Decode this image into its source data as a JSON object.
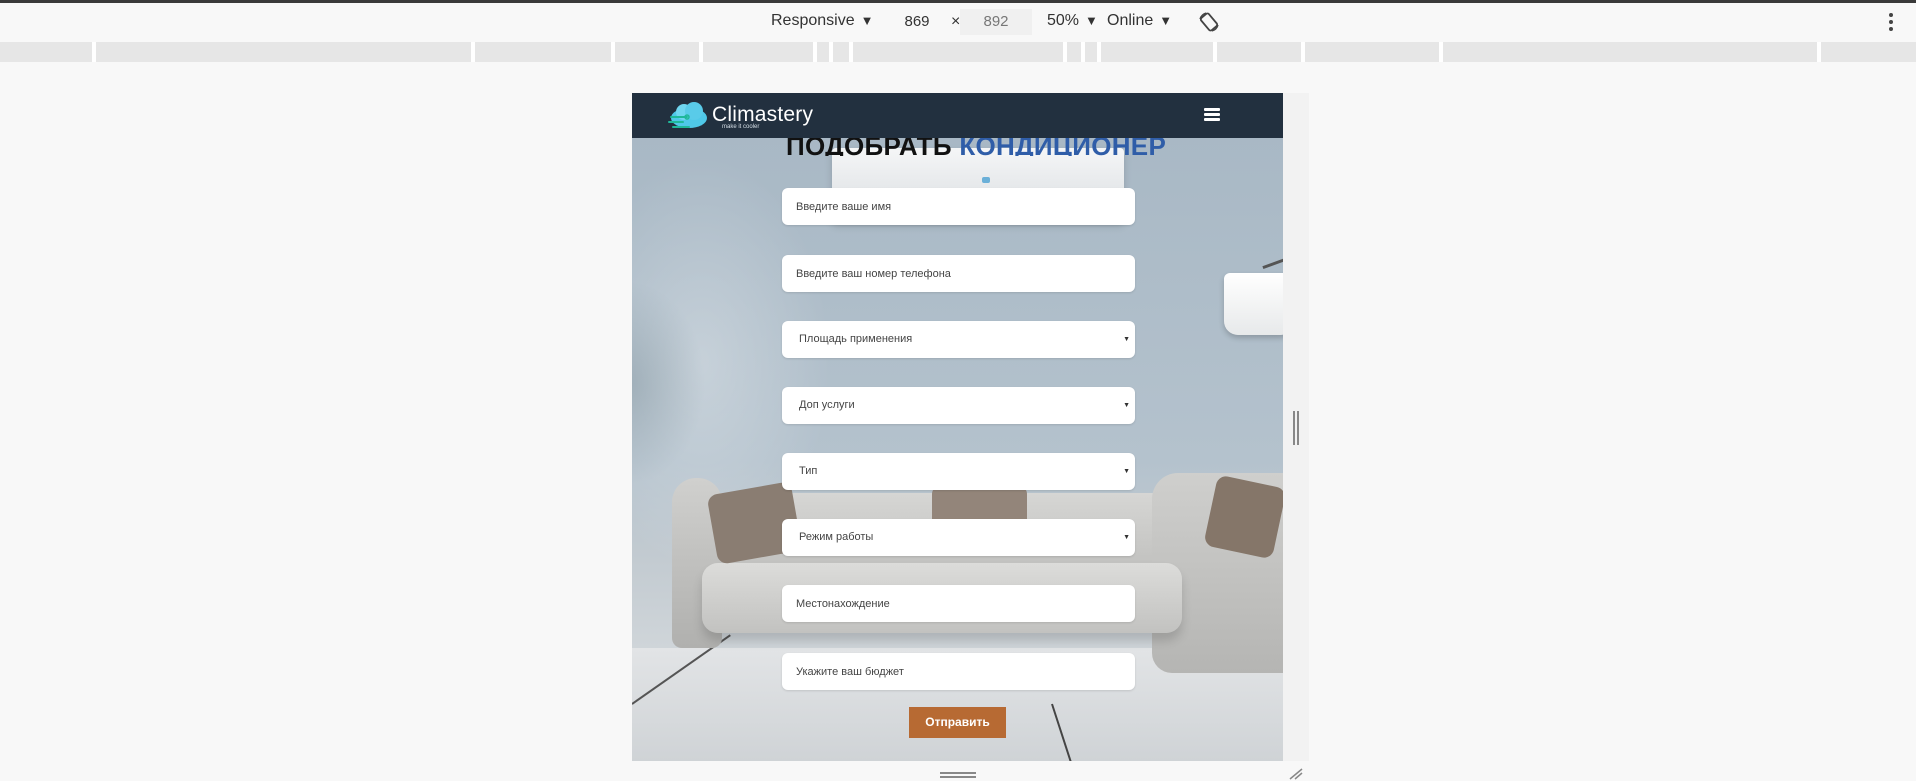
{
  "devtools": {
    "device": "Responsive",
    "width": "869",
    "height": "892",
    "times": "×",
    "zoom": "50%",
    "network": "Online",
    "rotate_icon": "rotate-icon",
    "menu_icon": "kebab-icon"
  },
  "site": {
    "logo": {
      "name": "Climastery",
      "tagline": "make it cooler"
    },
    "menu_icon": "hamburger-icon",
    "title_part1": "ПОДОБРАТЬ",
    "title_part2": "КОНДИЦИОНЕР",
    "colors": {
      "header_bg": "#22303f",
      "title_accent": "#2f5da8",
      "submit_bg": "#b76a33"
    },
    "form": {
      "name_placeholder": "Введите ваше имя",
      "phone_placeholder": "Введите ваш номер телефона",
      "area_select": "Площадь применения",
      "extras_select": "Доп услуги",
      "type_select": "Тип",
      "mode_select": "Режим работы",
      "location_placeholder": "Местонахождение",
      "budget_placeholder": "Укажите ваш бюджет",
      "submit_label": "Отправить"
    }
  }
}
